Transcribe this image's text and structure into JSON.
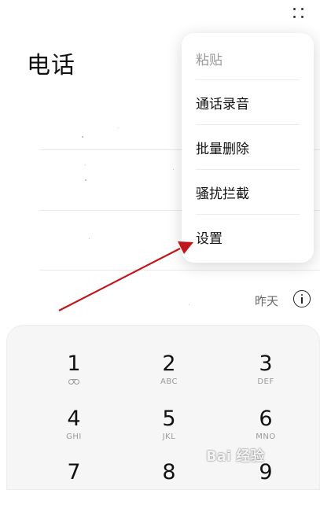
{
  "header": {
    "title": "电话",
    "more_icon": "more-vertical-icon"
  },
  "menu": {
    "items": [
      {
        "label": "粘贴",
        "enabled": false
      },
      {
        "label": "通话录音",
        "enabled": true
      },
      {
        "label": "批量删除",
        "enabled": true
      },
      {
        "label": "骚扰拦截",
        "enabled": true
      },
      {
        "label": "设置",
        "enabled": true
      }
    ]
  },
  "call_log": {
    "last_row_date": "昨天",
    "info_icon": "info-icon"
  },
  "keypad": {
    "keys": [
      {
        "digit": "1",
        "letters": "",
        "icon": "voicemail-icon"
      },
      {
        "digit": "2",
        "letters": "ABC"
      },
      {
        "digit": "3",
        "letters": "DEF"
      },
      {
        "digit": "4",
        "letters": "GHI"
      },
      {
        "digit": "5",
        "letters": "JKL"
      },
      {
        "digit": "6",
        "letters": "MNO"
      },
      {
        "digit": "7",
        "letters": ""
      },
      {
        "digit": "8",
        "letters": ""
      },
      {
        "digit": "9",
        "letters": ""
      }
    ]
  },
  "annotation": {
    "arrow_color": "#c0161c",
    "arrow_icon": "red-pointer-arrow"
  },
  "watermark": {
    "text": "Bai 经验"
  }
}
